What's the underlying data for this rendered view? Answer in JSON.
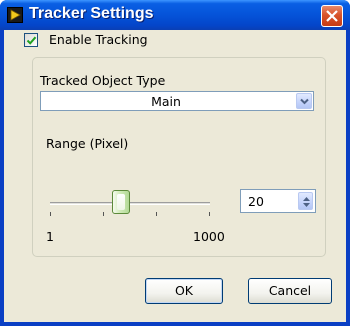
{
  "window": {
    "title": "Tracker Settings",
    "icons": {
      "app": "labview-app-icon",
      "close": "close-icon"
    },
    "colors": {
      "titlebar": "#0553d9",
      "close": "#d9532a",
      "client": "#ece9d8"
    }
  },
  "tracking": {
    "enable_label": "Enable Tracking",
    "enabled": true
  },
  "object_type": {
    "label": "Tracked Object Type",
    "value": "Main"
  },
  "range": {
    "label": "Range (Pixel)",
    "min_label": "1",
    "max_label": "1000",
    "value": "20",
    "slider_fraction": 0.4
  },
  "buttons": {
    "ok": "OK",
    "cancel": "Cancel"
  }
}
